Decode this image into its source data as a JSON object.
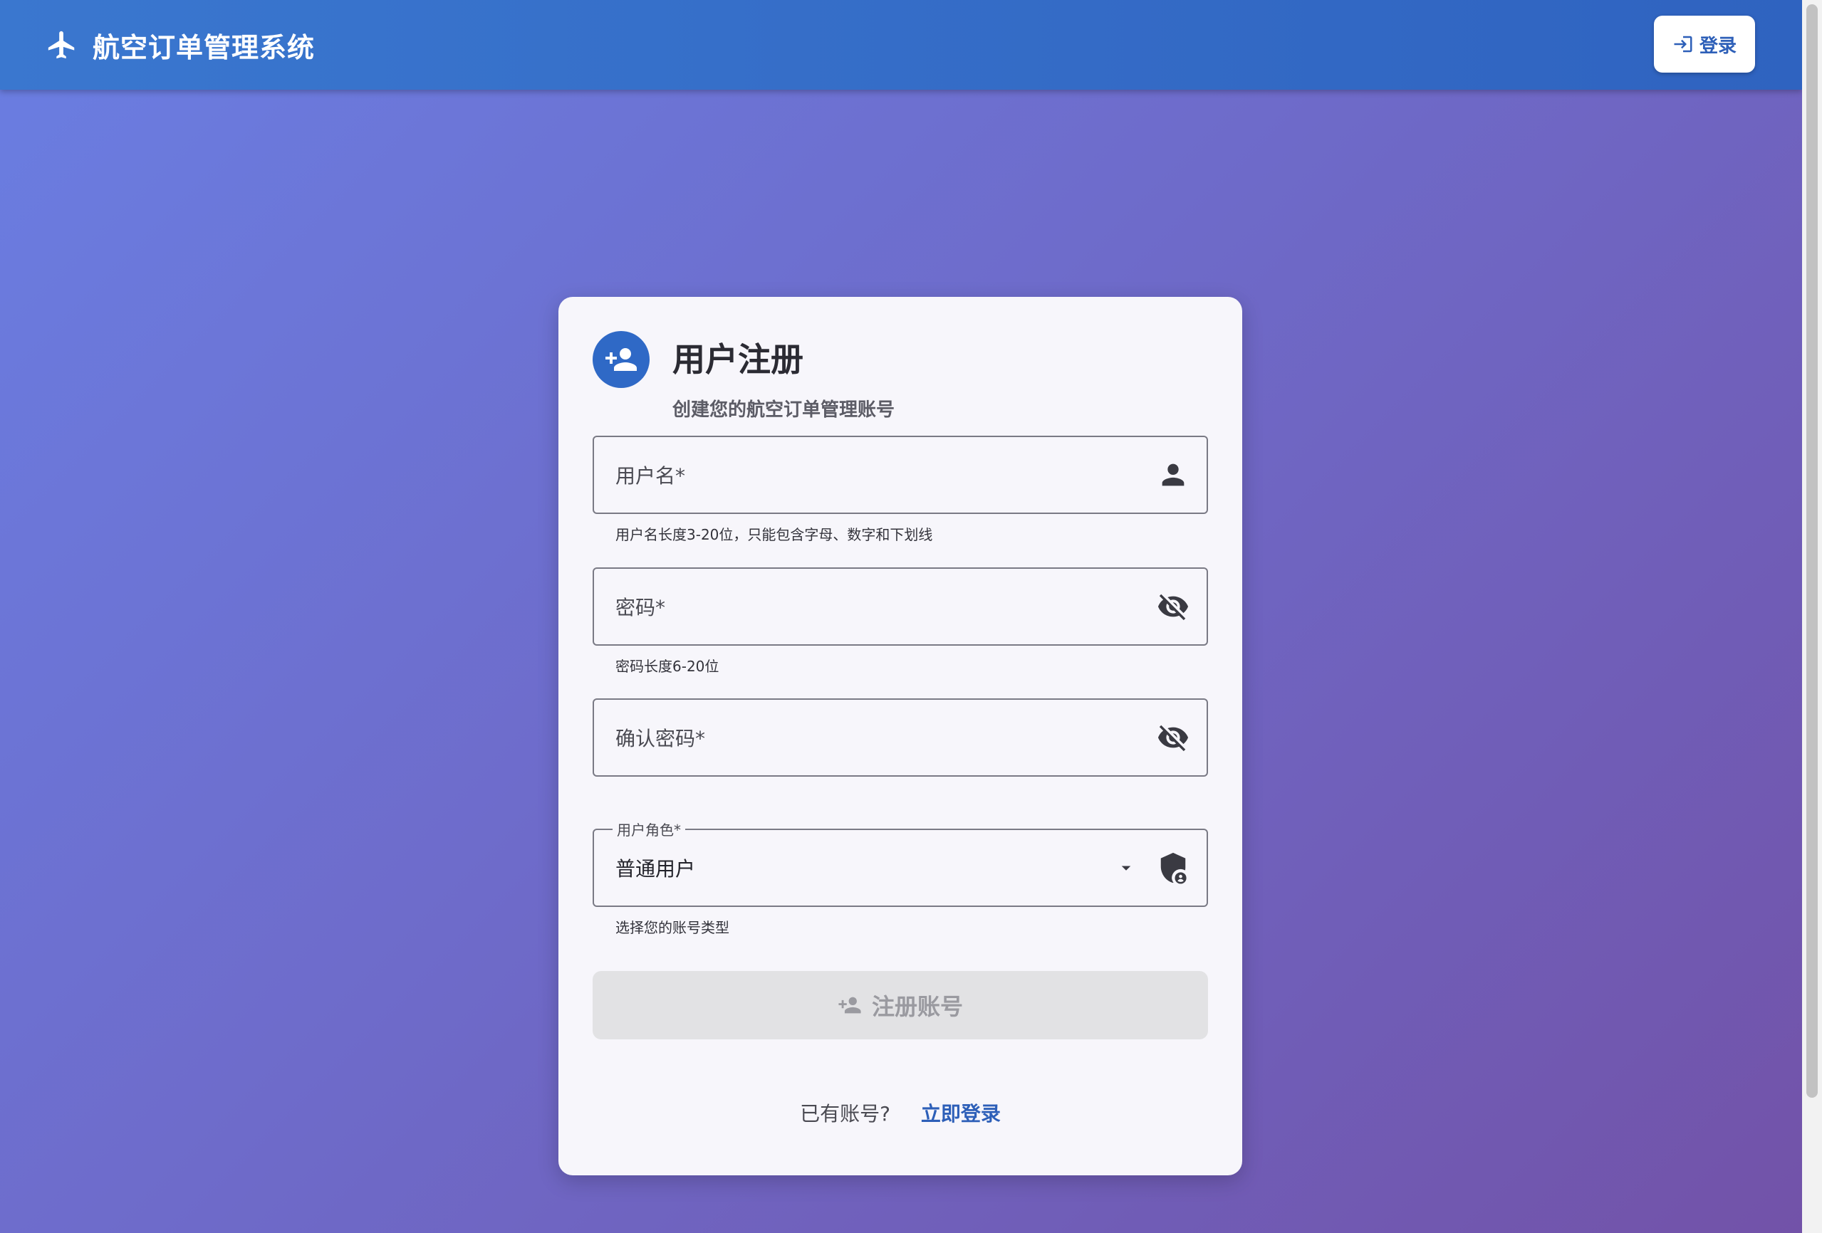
{
  "header": {
    "title": "航空订单管理系统",
    "login_label": "登录"
  },
  "card": {
    "title": "用户注册",
    "subtitle": "创建您的航空订单管理账号"
  },
  "form": {
    "username": {
      "label": "用户名*",
      "hint": "用户名长度3-20位，只能包含字母、数字和下划线"
    },
    "password": {
      "label": "密码*",
      "hint": "密码长度6-20位"
    },
    "confirm_password": {
      "label": "确认密码*"
    },
    "role": {
      "label": "用户角色*",
      "value": "普通用户",
      "hint": "选择您的账号类型"
    },
    "submit_label": "注册账号"
  },
  "footer": {
    "question": "已有账号?",
    "link": "立即登录"
  },
  "icons": {
    "brand": "airplane-icon",
    "login": "login-icon",
    "avatar": "person-add-icon",
    "username": "person-icon",
    "password_toggle": "visibility-off-icon",
    "role": "admin-shield-icon",
    "dropdown": "arrow-drop-down-icon"
  },
  "colors": {
    "primary": "#2f69c6",
    "header": "#346bc6",
    "link": "#2d5fb8",
    "disabled_button": "#e2e2e4"
  }
}
